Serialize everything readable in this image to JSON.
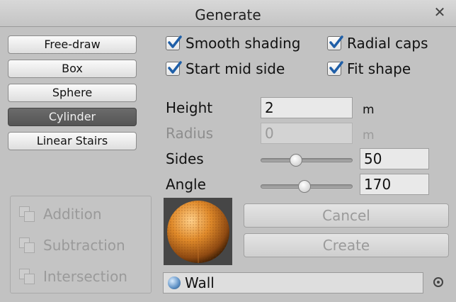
{
  "window": {
    "title": "Generate"
  },
  "modes": [
    {
      "label": "Free-draw",
      "active": false
    },
    {
      "label": "Box",
      "active": false
    },
    {
      "label": "Sphere",
      "active": false
    },
    {
      "label": "Cylinder",
      "active": true
    },
    {
      "label": "Linear Stairs",
      "active": false
    }
  ],
  "csg": {
    "items": [
      {
        "label": "Addition",
        "enabled": false
      },
      {
        "label": "Subtraction",
        "enabled": false
      },
      {
        "label": "Intersection",
        "enabled": false
      }
    ]
  },
  "options": {
    "smooth_shading": {
      "label": "Smooth shading",
      "checked": true
    },
    "radial_caps": {
      "label": "Radial caps",
      "checked": true
    },
    "start_mid_side": {
      "label": "Start mid side",
      "checked": true
    },
    "fit_shape": {
      "label": "Fit shape",
      "checked": true
    }
  },
  "fields": {
    "height": {
      "label": "Height",
      "value": "2",
      "unit": "m"
    },
    "radius": {
      "label": "Radius",
      "value": "0",
      "unit": "m",
      "enabled": false
    },
    "sides": {
      "label": "Sides",
      "value": "50",
      "slider_fraction": 0.37
    },
    "angle": {
      "label": "Angle",
      "value": "170",
      "slider_fraction": 0.47
    }
  },
  "actions": {
    "cancel_label": "Cancel",
    "create_label": "Create"
  },
  "material": {
    "label": "Wall",
    "icon": "sphere-material-icon"
  },
  "colors": {
    "accent_check": "#1f5fa8",
    "preview_sphere": "#e08a2a"
  }
}
